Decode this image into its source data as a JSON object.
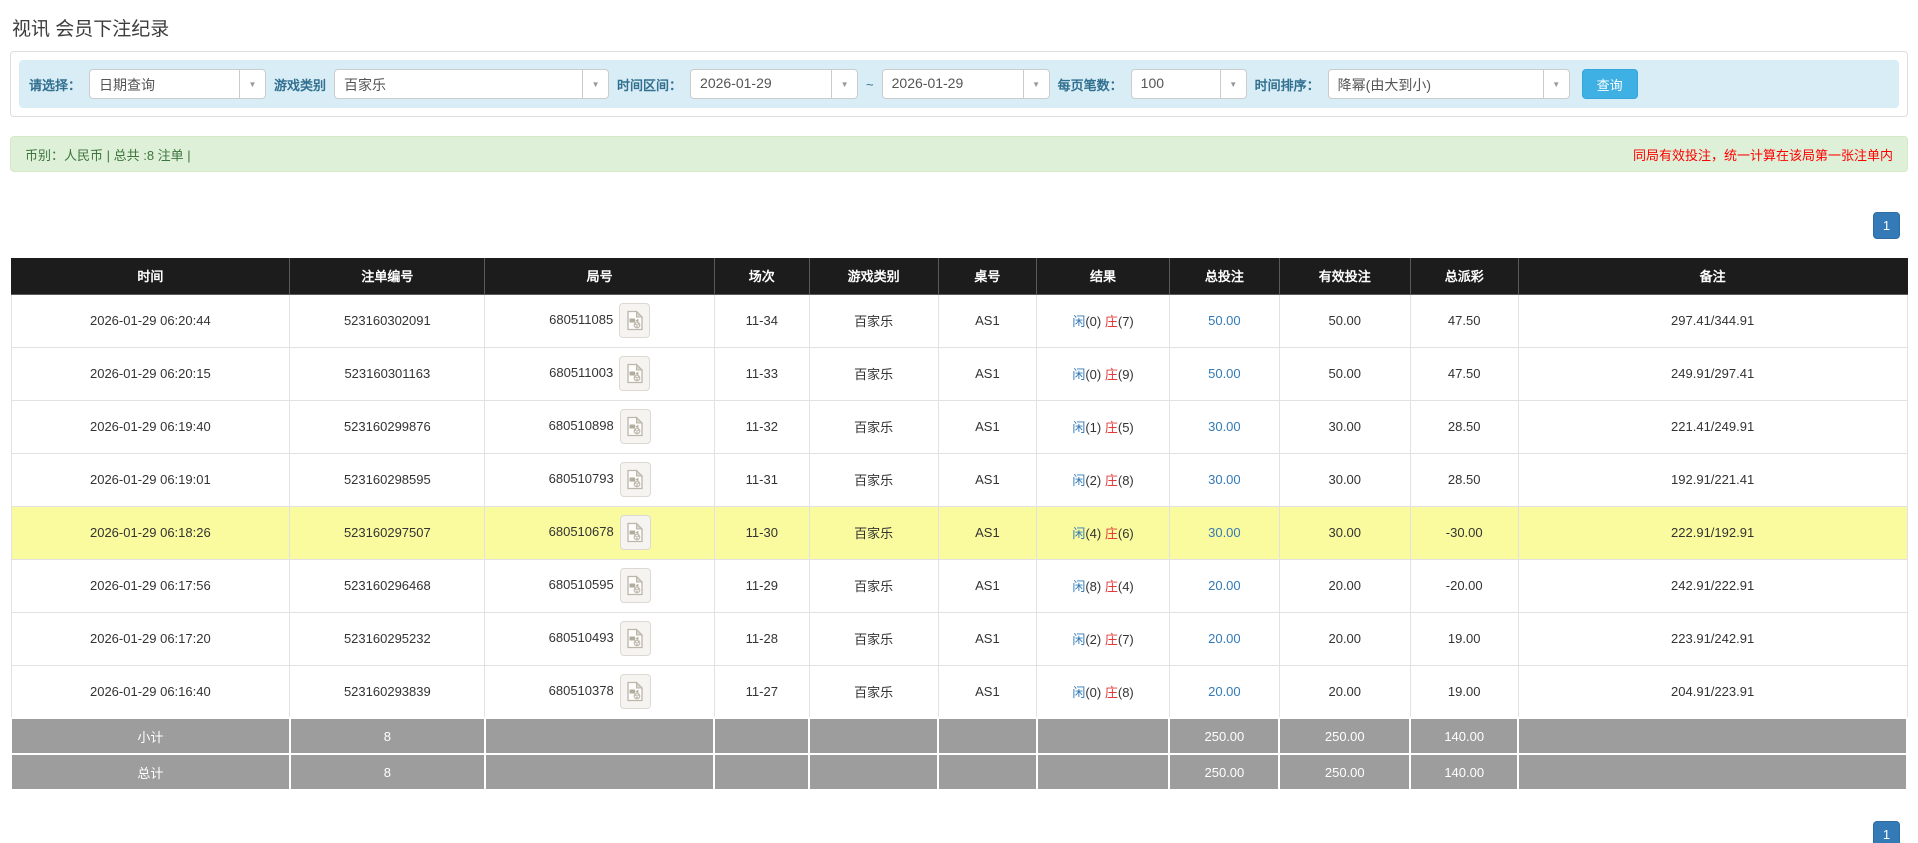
{
  "page": {
    "title": "视讯 会员下注纪录"
  },
  "colors": {
    "accent_blue": "#337ab7",
    "search_button": "#3fb0e4",
    "header_black": "#1c1c1c",
    "highlight_yellow": "#fafa9e",
    "success_bg": "#dff0d8",
    "success_text": "#3c763d",
    "notice_red": "#ff0000",
    "summary_gray": "#9d9d9d"
  },
  "icons": {
    "combo_arrow": "chevron-down-icon",
    "round_video": "video-file-icon"
  },
  "filters": {
    "select_label": "请选择：",
    "select_value": "日期查询",
    "game_type_label": "游戏类别",
    "game_type_value": "百家乐",
    "time_range_label": "时间区间：",
    "date_from": "2026-01-29",
    "tilde": "~",
    "date_to": "2026-01-29",
    "page_size_label": "每页笔数：",
    "page_size_value": "100",
    "sort_label": "时间排序：",
    "sort_value": "降幂(由大到小)",
    "search_button": "查询"
  },
  "summary_bar": {
    "left_text": "币别：人民币 | 总共 :8 注单 |",
    "right_notice": "同局有效投注，统一计算在该局第一张注单内"
  },
  "pagination": {
    "page": "1"
  },
  "table": {
    "headers": [
      "时间",
      "注单编号",
      "局号",
      "场次",
      "游戏类别",
      "桌号",
      "结果",
      "总投注",
      "有效投注",
      "总派彩",
      "备注"
    ],
    "rows": [
      {
        "time": "2026-01-29 06:20:44",
        "bet_id": "523160302091",
        "round_id": "680511085",
        "session": "11-34",
        "game": "百家乐",
        "table_no": "AS1",
        "result": {
          "player_label": "闲",
          "player": "(0)",
          "banker_label": "庄",
          "banker": "(7)"
        },
        "total_bet": "50.00",
        "valid_bet": "50.00",
        "payout": "47.50",
        "payout_negative": false,
        "note": "297.41/344.91",
        "highlight": false
      },
      {
        "time": "2026-01-29 06:20:15",
        "bet_id": "523160301163",
        "round_id": "680511003",
        "session": "11-33",
        "game": "百家乐",
        "table_no": "AS1",
        "result": {
          "player_label": "闲",
          "player": "(0)",
          "banker_label": "庄",
          "banker": "(9)"
        },
        "total_bet": "50.00",
        "valid_bet": "50.00",
        "payout": "47.50",
        "payout_negative": false,
        "note": "249.91/297.41",
        "highlight": false
      },
      {
        "time": "2026-01-29 06:19:40",
        "bet_id": "523160299876",
        "round_id": "680510898",
        "session": "11-32",
        "game": "百家乐",
        "table_no": "AS1",
        "result": {
          "player_label": "闲",
          "player": "(1)",
          "banker_label": "庄",
          "banker": "(5)"
        },
        "total_bet": "30.00",
        "valid_bet": "30.00",
        "payout": "28.50",
        "payout_negative": false,
        "note": "221.41/249.91",
        "highlight": false
      },
      {
        "time": "2026-01-29 06:19:01",
        "bet_id": "523160298595",
        "round_id": "680510793",
        "session": "11-31",
        "game": "百家乐",
        "table_no": "AS1",
        "result": {
          "player_label": "闲",
          "player": "(2)",
          "banker_label": "庄",
          "banker": "(8)"
        },
        "total_bet": "30.00",
        "valid_bet": "30.00",
        "payout": "28.50",
        "payout_negative": false,
        "note": "192.91/221.41",
        "highlight": false
      },
      {
        "time": "2026-01-29 06:18:26",
        "bet_id": "523160297507",
        "round_id": "680510678",
        "session": "11-30",
        "game": "百家乐",
        "table_no": "AS1",
        "result": {
          "player_label": "闲",
          "player": "(4)",
          "banker_label": "庄",
          "banker": "(6)"
        },
        "total_bet": "30.00",
        "valid_bet": "30.00",
        "payout": "-30.00",
        "payout_negative": true,
        "note": "222.91/192.91",
        "highlight": true
      },
      {
        "time": "2026-01-29 06:17:56",
        "bet_id": "523160296468",
        "round_id": "680510595",
        "session": "11-29",
        "game": "百家乐",
        "table_no": "AS1",
        "result": {
          "player_label": "闲",
          "player": "(8)",
          "banker_label": "庄",
          "banker": "(4)"
        },
        "total_bet": "20.00",
        "valid_bet": "20.00",
        "payout": "-20.00",
        "payout_negative": true,
        "note": "242.91/222.91",
        "highlight": false
      },
      {
        "time": "2026-01-29 06:17:20",
        "bet_id": "523160295232",
        "round_id": "680510493",
        "session": "11-28",
        "game": "百家乐",
        "table_no": "AS1",
        "result": {
          "player_label": "闲",
          "player": "(2)",
          "banker_label": "庄",
          "banker": "(7)"
        },
        "total_bet": "20.00",
        "valid_bet": "20.00",
        "payout": "19.00",
        "payout_negative": false,
        "note": "223.91/242.91",
        "highlight": false
      },
      {
        "time": "2026-01-29 06:16:40",
        "bet_id": "523160293839",
        "round_id": "680510378",
        "session": "11-27",
        "game": "百家乐",
        "table_no": "AS1",
        "result": {
          "player_label": "闲",
          "player": "(0)",
          "banker_label": "庄",
          "banker": "(8)"
        },
        "total_bet": "20.00",
        "valid_bet": "20.00",
        "payout": "19.00",
        "payout_negative": false,
        "note": "204.91/223.91",
        "highlight": false
      }
    ],
    "subtotal": {
      "label": "小计",
      "count": "8",
      "total_bet": "250.00",
      "valid_bet": "250.00",
      "payout": "140.00"
    },
    "total": {
      "label": "总计",
      "count": "8",
      "total_bet": "250.00",
      "valid_bet": "250.00",
      "payout": "140.00"
    }
  }
}
